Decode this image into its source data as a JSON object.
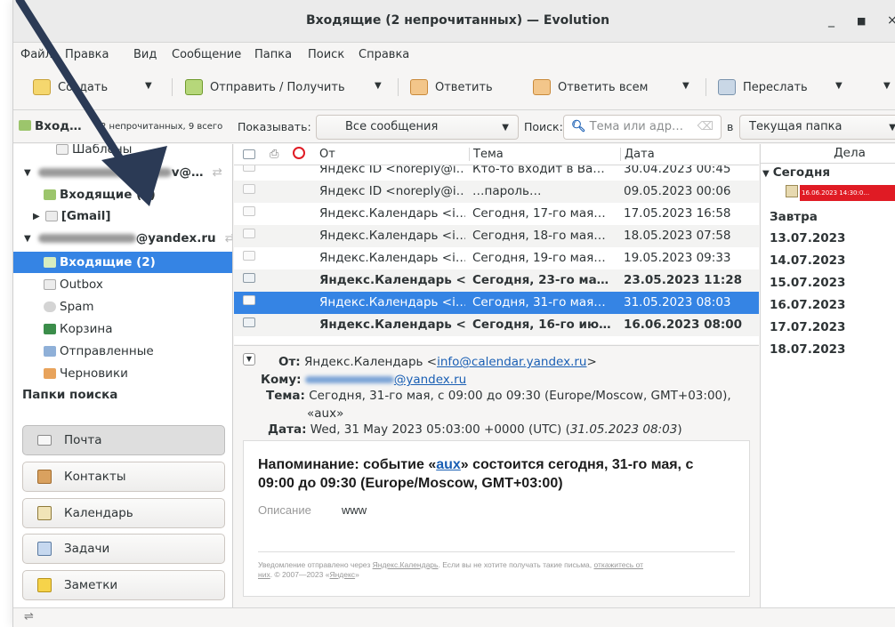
{
  "window": {
    "title": "Входящие (2 непрочитанных) — Evolution"
  },
  "menu": [
    "Файл",
    "Правка",
    "Вид",
    "Сообщение",
    "Папка",
    "Поиск",
    "Справка"
  ],
  "toolbar": {
    "new": "Создать",
    "send_receive": "Отправить / Получить",
    "reply": "Ответить",
    "reply_all": "Ответить всем",
    "forward": "Переслать"
  },
  "filterbar": {
    "folder_name": "Вход…",
    "folder_counts": "2 непрочитанных, 9 всего",
    "show_label": "Показывать:",
    "show_value": "Все сообщения",
    "search_label": "Поиск:",
    "search_placeholder": "Тема или адр…",
    "in_label": "в",
    "scope_value": "Текущая папка"
  },
  "sidebar": {
    "drafts_partial": "Шаблоны",
    "account1_suffix": "v@…",
    "account1_inbox": "Входящие (9)",
    "account1_gmail": "[Gmail]",
    "account2_suffix": "@yandex.ru",
    "inbox": "Входящие (2)",
    "outbox": "Outbox",
    "spam": "Spam",
    "trash": "Корзина",
    "sent": "Отправленные",
    "drafts": "Черновики",
    "search_folders": "Папки поиска"
  },
  "switcher": {
    "mail": "Почта",
    "contacts": "Контакты",
    "calendar": "Календарь",
    "tasks": "Задачи",
    "memos": "Заметки"
  },
  "message_list": {
    "columns": {
      "from": "От",
      "subject": "Тема",
      "date": "Дата"
    },
    "rows": [
      {
        "from": "Яндекс ID <noreply@i…",
        "subject": "Кто-то входит в Ва…",
        "date": "30.04.2023 00:45",
        "bold": false
      },
      {
        "from": "Яндекс ID <noreply@i…",
        "subject": "…пароль…",
        "date": "09.05.2023 00:06",
        "bold": false
      },
      {
        "from": "Яндекс.Календарь <i…",
        "subject": "Сегодня, 17-го мая…",
        "date": "17.05.2023 16:58",
        "bold": false
      },
      {
        "from": "Яндекс.Календарь <i…",
        "subject": "Сегодня, 18-го мая…",
        "date": "18.05.2023 07:58",
        "bold": false
      },
      {
        "from": "Яндекс.Календарь <i…",
        "subject": "Сегодня, 19-го мая…",
        "date": "19.05.2023 09:33",
        "bold": false
      },
      {
        "from": "Яндекс.Календарь <…",
        "subject": "Сегодня, 23-го ма…",
        "date": "23.05.2023 11:28",
        "bold": true
      },
      {
        "from": "Яндекс.Календарь <i…",
        "subject": "Сегодня, 31-го мая…",
        "date": "31.05.2023 08:03",
        "bold": false
      },
      {
        "from": "Яндекс.Календарь <…",
        "subject": "Сегодня, 16-го ию…",
        "date": "16.06.2023 08:00",
        "bold": true
      }
    ]
  },
  "preview": {
    "from_label": "От:",
    "from_name": "Яндекс.Календарь <",
    "from_email": "info@calendar.yandex.ru",
    "from_close": ">",
    "to_label": "Кому:",
    "to_email": "@yandex.ru",
    "subject_label": "Тема:",
    "subject_line1": "Сегодня, 31-го мая, с 09:00 до 09:30 (Europe/Moscow, GMT+03:00),",
    "subject_line2": "«aux»",
    "date_label": "Дата:",
    "date_value": "Wed, 31 May 2023 05:03:00 +0000 (UTC) (",
    "date_local": "31.05.2023 08:03",
    "date_close": ")",
    "body_title_a": "Напоминание: событие «",
    "body_title_link": "aux",
    "body_title_b": "» состоится сегодня, 31-го мая, с",
    "body_title_line2": "09:00 до 09:30 (Europe/Moscow, GMT+03:00)",
    "desc_label": "Описание",
    "desc_value": "www",
    "footer_a": "Уведомление отправлено через ",
    "footer_link1": "Яндекс.Календарь",
    "footer_b": ". Если вы не хотите получать такие письма, ",
    "footer_link2": "откажитесь от",
    "footer_link3": "них",
    "footer_c": ". © 2007—2023 «",
    "footer_link4": "Яндекс",
    "footer_d": "»"
  },
  "tasks_pane": {
    "header": "Дела",
    "today": "Сегодня",
    "today_item": "16.06.2023 14:30:0…",
    "tomorrow": "Завтра",
    "dates": [
      "13.07.2023",
      "14.07.2023",
      "15.07.2023",
      "16.07.2023",
      "17.07.2023",
      "18.07.2023"
    ]
  },
  "colors": {
    "selection": "#3584e4",
    "overdue": "#e01b24",
    "link": "#1a5fb4"
  }
}
